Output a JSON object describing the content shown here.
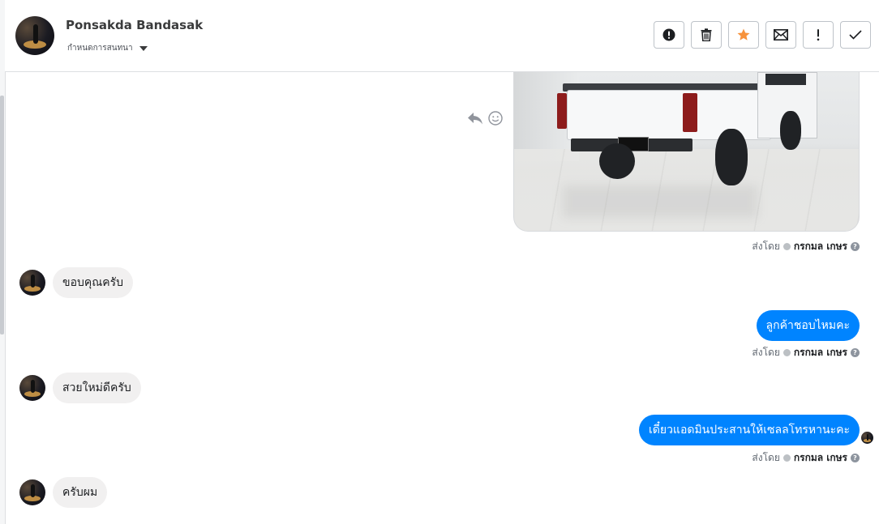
{
  "header": {
    "contact_name": "Ponsakda Bandasak",
    "conversation_menu_label": "กำหนดการสนทนา",
    "toolbar": [
      {
        "name": "report-spam",
        "icon": "exclamation-circle-icon"
      },
      {
        "name": "delete",
        "icon": "trash-icon"
      },
      {
        "name": "star",
        "icon": "star-icon",
        "color": "#f7923b"
      },
      {
        "name": "mark-unread",
        "icon": "envelope-icon"
      },
      {
        "name": "follow-up",
        "icon": "exclamation-icon"
      },
      {
        "name": "mark-done",
        "icon": "checkmark-icon"
      }
    ]
  },
  "thread": {
    "photo_meta": {
      "sent_by_label": "ส่งโดย",
      "agent_name": "กรกมล เกษร"
    },
    "messages": [
      {
        "direction": "in",
        "text": "ขอบคุณครับ"
      },
      {
        "direction": "out",
        "text": "ลูกค้าชอบไหมคะ",
        "sent_by_label": "ส่งโดย",
        "agent_name": "กรกมล เกษร"
      },
      {
        "direction": "in",
        "text": "สวยใหม่ดีครับ"
      },
      {
        "direction": "out",
        "text": "เดี๋ยวแอดมินประสานให้เซลลโทรหานะคะ",
        "sent_by_label": "ส่งโดย",
        "agent_name": "กรกมล เกษร"
      },
      {
        "direction": "in",
        "text": "ครับผม"
      }
    ]
  },
  "colors": {
    "outgoing_bubble": "#0084ff",
    "incoming_bubble": "#f1f0f0",
    "star_accent": "#f7923b"
  }
}
